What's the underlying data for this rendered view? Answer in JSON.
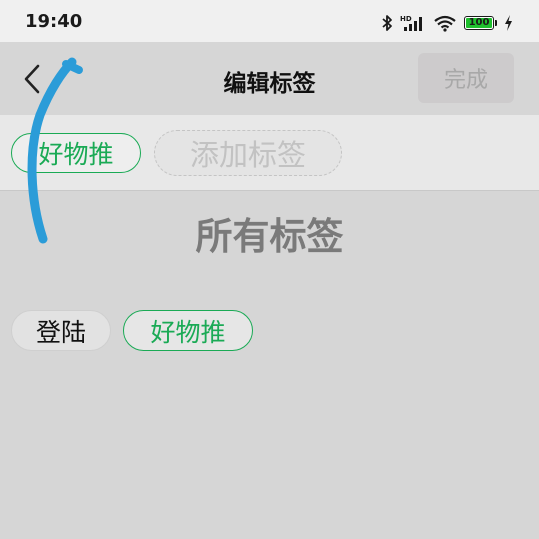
{
  "status_bar": {
    "time": "19:40",
    "battery_level": "100",
    "battery_color": "#1fc02e",
    "icons": [
      "bluetooth-icon",
      "hd-signal-icon",
      "wifi-icon",
      "battery-icon",
      "charging-icon"
    ]
  },
  "nav": {
    "back_icon": "chevron-left-icon",
    "title": "编辑标签",
    "done_label": "完成"
  },
  "current_tags": {
    "selected": [
      "好物推"
    ],
    "add_placeholder": "添加标签"
  },
  "all_tags": {
    "title": "所有标签",
    "items": [
      "登陆",
      "好物推"
    ]
  },
  "colors": {
    "accent": "#1aaa55",
    "swipe_gesture": "#2b9cd8"
  }
}
